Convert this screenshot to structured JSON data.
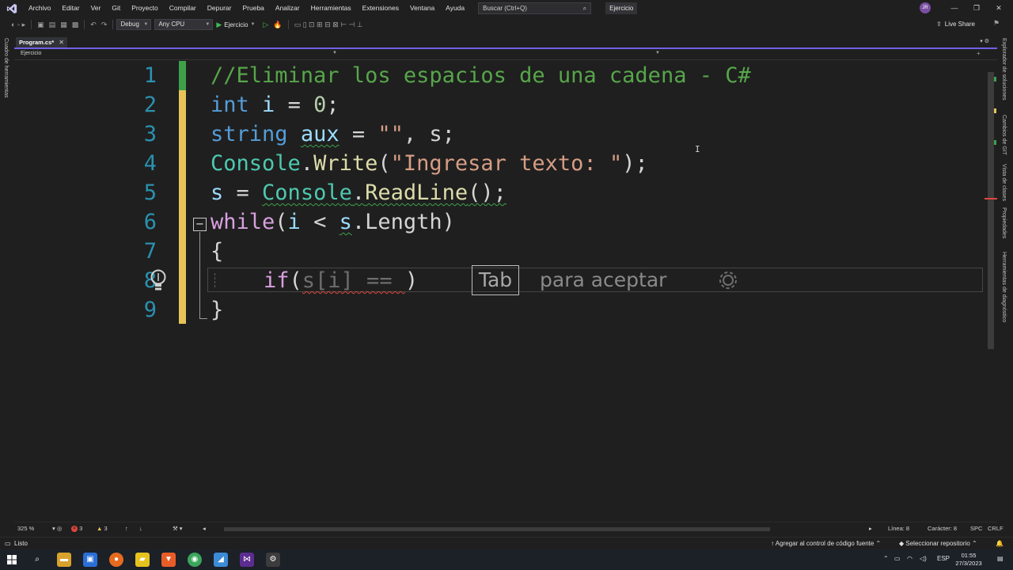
{
  "menu": [
    "Archivo",
    "Editar",
    "Ver",
    "Git",
    "Proyecto",
    "Compilar",
    "Depurar",
    "Prueba",
    "Analizar",
    "Herramientas",
    "Extensiones",
    "Ventana",
    "Ayuda"
  ],
  "search": {
    "placeholder": "Buscar (Ctrl+Q)"
  },
  "solution_name": "Ejercicio",
  "user_initials": "JR",
  "toolbar": {
    "config": "Debug",
    "platform": "Any CPU",
    "run_label": "Ejercicio",
    "live_share": "Live Share"
  },
  "left_panel": {
    "label": "Cuadro de herramientas"
  },
  "right_panels": [
    "Explorador de soluciones",
    "Cambios de GIT",
    "Vista de clases",
    "Propiedades",
    "Herramientas de diagnóstico"
  ],
  "document_tab": {
    "title": "Program.cs*",
    "close": "✕"
  },
  "nav": {
    "project": "Ejercicio"
  },
  "line_numbers": [
    "1",
    "2",
    "3",
    "4",
    "5",
    "6",
    "7",
    "8",
    "9"
  ],
  "code": {
    "l1": "//Eliminar los espacios de una cadena - C#",
    "l2": {
      "kw": "int",
      "var": "i",
      "op": " = ",
      "num": "0",
      "end": ";"
    },
    "l3": {
      "kw": "string",
      "var": "aux",
      "op": " = ",
      "str": "\"\"",
      "rest": ", s;"
    },
    "l4": {
      "type": "Console",
      "dot": ".",
      "method": "Write",
      "open": "(",
      "str": "\"Ingresar texto: \"",
      "end": ");"
    },
    "l5": {
      "var": "s",
      "op": " = ",
      "type": "Console",
      "dot": ".",
      "method": "ReadLine",
      "end": "();"
    },
    "l6": {
      "kw": "while",
      "open": "(",
      "var": "i",
      "op": " < ",
      "obj": "s",
      "prop": ".Length",
      "end": ")"
    },
    "l7": "{",
    "l8": {
      "kw": "if",
      "open": "(",
      "ghost": "s[i] == ",
      "close": ")"
    },
    "l9": "}"
  },
  "suggestion": {
    "key": "Tab",
    "hint": "para aceptar"
  },
  "editor_status": {
    "zoom": "325 %",
    "errors": "3",
    "warnings": "3",
    "line": "Línea: 8",
    "char": "Carácter: 8",
    "spc": "SPC",
    "crlf": "CRLF"
  },
  "status": {
    "ready": "Listo",
    "source_control": "Agregar al control de código fuente",
    "repo": "Seleccionar repositorio"
  },
  "taskbar": {
    "lang": "ESP",
    "time": "01:55",
    "date": "27/3/2023"
  },
  "colors": {
    "accent": "#7160e8",
    "keyword": "#569cd6",
    "type": "#4ec9b0",
    "string": "#d69d85",
    "comment": "#57a64a",
    "method": "#dcdcaa",
    "control": "#d8a0df",
    "saved_change": "#3fa04a",
    "unsaved_change": "#e8c35a",
    "error": "#e0463d"
  }
}
